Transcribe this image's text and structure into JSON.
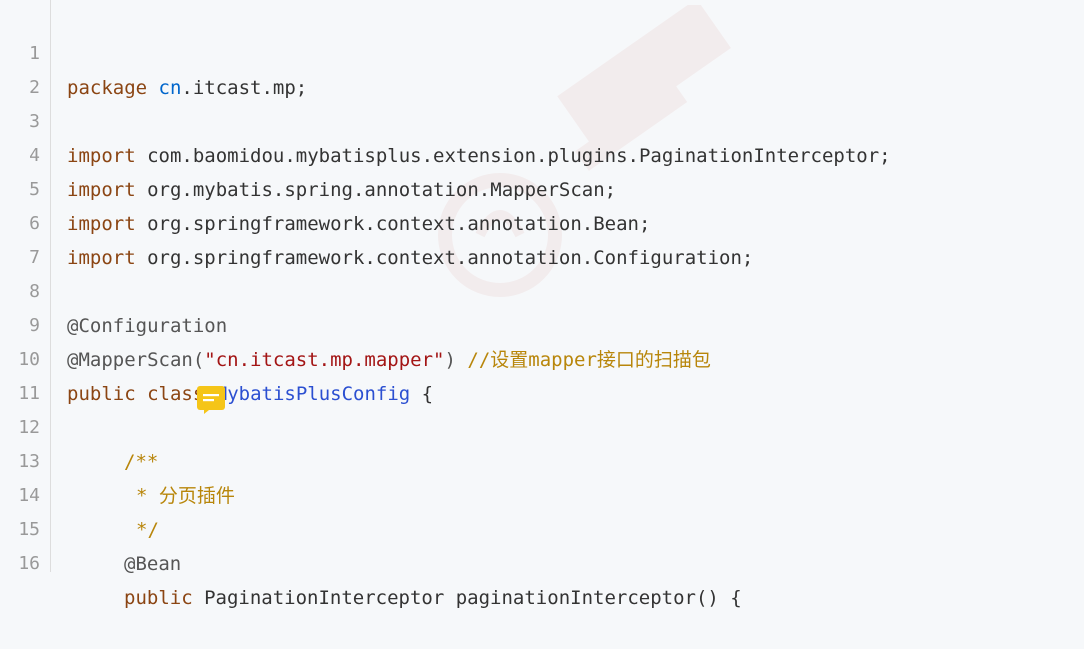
{
  "lines": [
    {
      "n": "1",
      "text": "package cn.itcast.mp;"
    },
    {
      "n": "2",
      "text": ""
    },
    {
      "n": "3",
      "text": "import com.baomidou.mybatisplus.extension.plugins.PaginationInterceptor;"
    },
    {
      "n": "4",
      "text": "import org.mybatis.spring.annotation.MapperScan;"
    },
    {
      "n": "5",
      "text": "import org.springframework.context.annotation.Bean;"
    },
    {
      "n": "6",
      "text": "import org.springframework.context.annotation.Configuration;"
    },
    {
      "n": "7",
      "text": ""
    },
    {
      "n": "8",
      "text": "@Configuration"
    },
    {
      "n": "9",
      "text": "@MapperScan(\"cn.itcast.mp.mapper\") //设置mapper接口的扫描包"
    },
    {
      "n": "10",
      "text": "public class MybatisPlusConfig {"
    },
    {
      "n": "11",
      "text": ""
    },
    {
      "n": "12",
      "text": "    /**"
    },
    {
      "n": "13",
      "text": "     * 分页插件"
    },
    {
      "n": "14",
      "text": "     */"
    },
    {
      "n": "15",
      "text": "    @Bean"
    },
    {
      "n": "16",
      "text": "    public PaginationInterceptor paginationInterceptor() {"
    }
  ],
  "tokens": {
    "l1": {
      "kw": "package",
      "pkg": "cn",
      "rest": ".itcast.mp;"
    },
    "l3": {
      "kw": "import",
      "rest": " com.baomidou.mybatisplus.extension.plugins.PaginationInterceptor;"
    },
    "l4": {
      "kw": "import",
      "rest": " org.mybatis.spring.annotation.MapperScan;"
    },
    "l5": {
      "kw": "import",
      "rest": " org.springframework.context.annotation.Bean;"
    },
    "l6": {
      "kw": "import",
      "rest": " org.springframework.context.annotation.Configuration;"
    },
    "l8": {
      "ann": "@Configuration"
    },
    "l9": {
      "ann": "@MapperScan(",
      "str": "\"cn.itcast.mp.mapper\"",
      "close": ") ",
      "cmt": "//设置mapper接口的扫描包"
    },
    "l10": {
      "kw1": "public",
      "kw2": "class",
      "cls": "MybatisPlusConfig",
      "rest": " {"
    },
    "l12": {
      "cmt": "/**"
    },
    "l13": {
      "cmt": "* 分页插件"
    },
    "l14": {
      "cmt": "*/"
    },
    "l15": {
      "ann": "@Bean"
    },
    "l16": {
      "kw1": "public",
      "rest": " PaginationInterceptor paginationInterceptor() {"
    }
  },
  "icons": {
    "note": "comment-note-icon",
    "watermark": "brand-watermark"
  },
  "colors": {
    "background": "#f6f8fa",
    "keyword": "#8b4513",
    "package": "#0066cc",
    "class": "#2b4fd1",
    "string": "#a31515",
    "comment": "#b8860b",
    "note_icon": "#f5c518"
  }
}
